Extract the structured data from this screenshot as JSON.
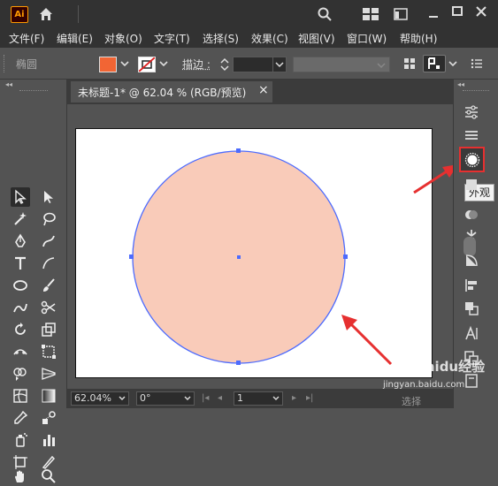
{
  "app": {
    "logo": "Ai"
  },
  "menu": [
    "文件(F)",
    "编辑(E)",
    "对象(O)",
    "文字(T)",
    "选择(S)",
    "效果(C)",
    "视图(V)",
    "窗口(W)",
    "帮助(H)"
  ],
  "control": {
    "selection_label": "椭圆",
    "stroke_label": "描边 :",
    "fill_color": "#f26534"
  },
  "document": {
    "tab_title": "未标题-1* @ 62.04 % (RGB/预览)",
    "close_glyph": "×"
  },
  "shape": {
    "fill_color": "#f9cbb9",
    "stroke_color": "#4d6bfe"
  },
  "panel": {
    "tooltip": "外观"
  },
  "status": {
    "zoom": "62.04%",
    "rotation": "0°",
    "artboard": "1",
    "select_hint": "选择"
  },
  "watermark": {
    "text": "Baidu经验",
    "url": "jingyan.baidu.com"
  }
}
